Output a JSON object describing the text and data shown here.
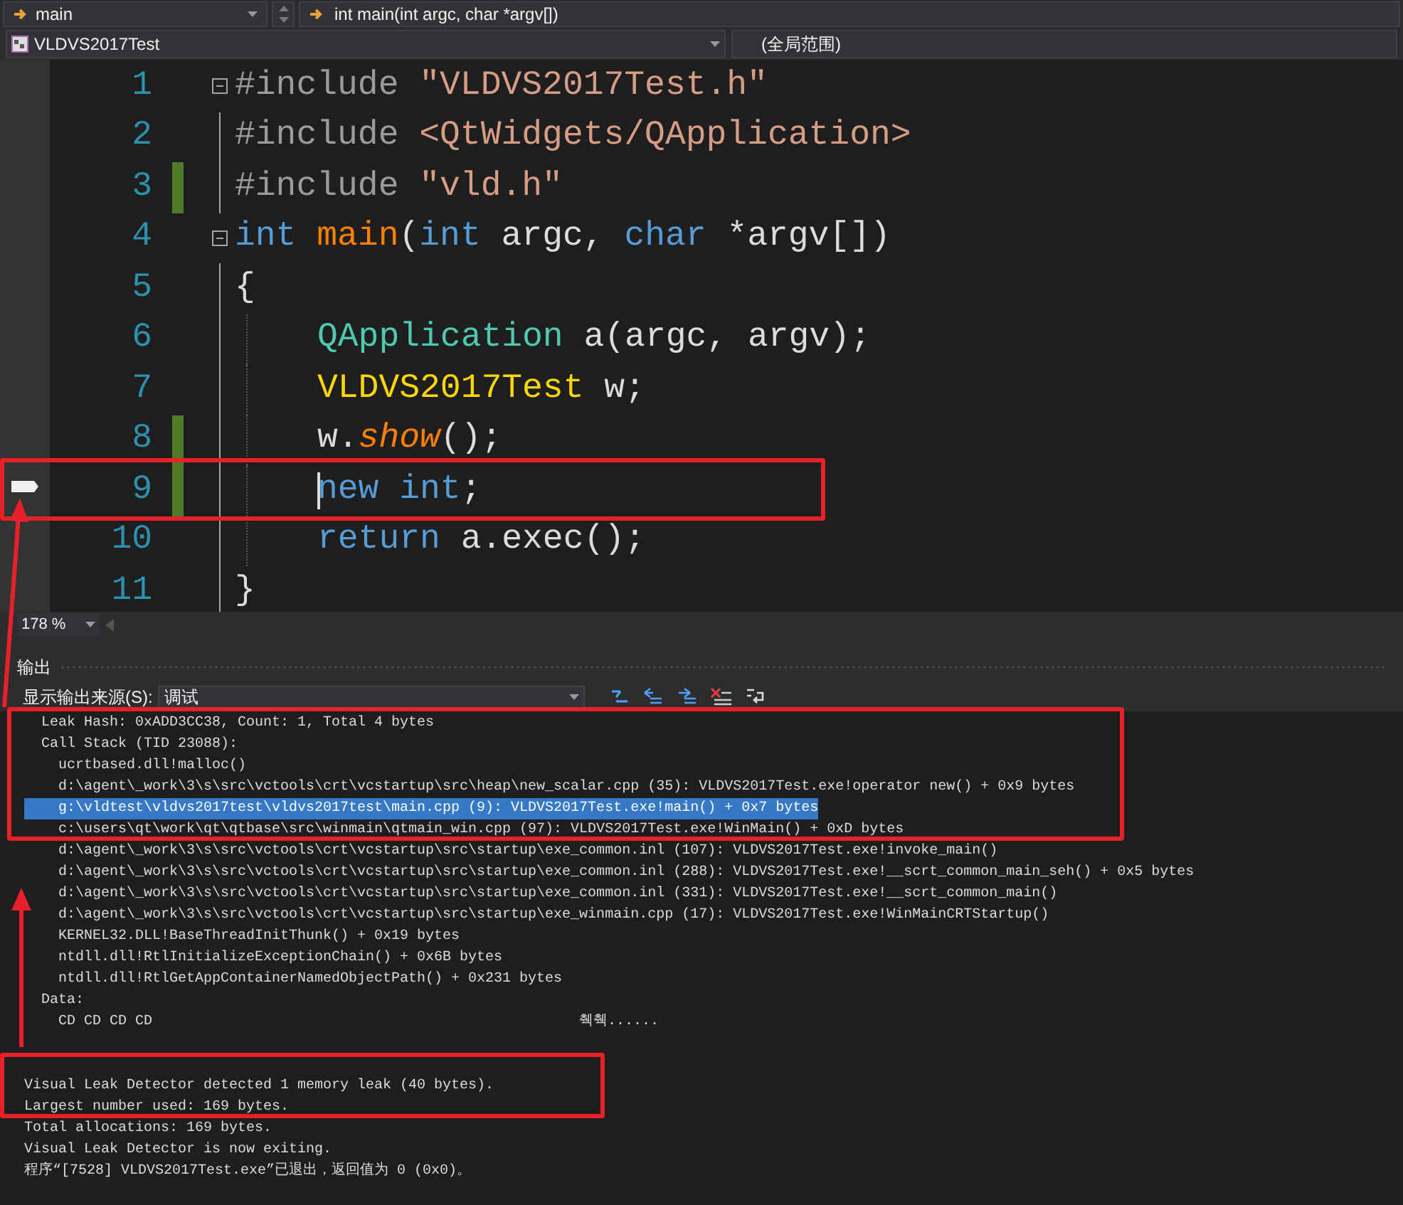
{
  "navigation_bar": {
    "member_dropdown": "main",
    "function_dropdown": "int main(int argc, char *argv[])"
  },
  "scope_bar": {
    "project_dropdown": "VLDVS2017Test",
    "scope_dropdown": "(全局范围)"
  },
  "editor": {
    "lines": [
      {
        "number": "1",
        "collapsible": true,
        "changed": false,
        "marker": false,
        "nested": false,
        "caret": false,
        "tokens": [
          {
            "t": "#include",
            "kind": "pre"
          },
          {
            "t": " \"VLDVS2017Test.h\"",
            "kind": "str"
          }
        ]
      },
      {
        "number": "2",
        "collapsible": false,
        "changed": false,
        "marker": false,
        "nested": false,
        "caret": false,
        "tokens": [
          {
            "t": "#include",
            "kind": "pre"
          },
          {
            "t": " <QtWidgets/QApplication>",
            "kind": "str"
          }
        ]
      },
      {
        "number": "3",
        "collapsible": false,
        "changed": true,
        "marker": false,
        "nested": false,
        "caret": false,
        "tokens": [
          {
            "t": "#include",
            "kind": "pre"
          },
          {
            "t": " \"vld.h\"",
            "kind": "str"
          }
        ]
      },
      {
        "number": "4",
        "collapsible": true,
        "changed": false,
        "marker": false,
        "nested": false,
        "caret": false,
        "tokens": [
          {
            "t": "int",
            "kind": "kw"
          },
          {
            "t": " main",
            "kind": "fn"
          },
          {
            "t": "(",
            "kind": "plain"
          },
          {
            "t": "int",
            "kind": "kw"
          },
          {
            "t": " argc, ",
            "kind": "plain"
          },
          {
            "t": "char",
            "kind": "kw"
          },
          {
            "t": " *argv[])",
            "kind": "plain"
          }
        ]
      },
      {
        "number": "5",
        "collapsible": false,
        "changed": false,
        "marker": false,
        "nested": false,
        "caret": false,
        "tokens": [
          {
            "t": "{",
            "kind": "plain"
          }
        ]
      },
      {
        "number": "6",
        "collapsible": false,
        "changed": false,
        "marker": false,
        "nested": true,
        "caret": false,
        "tokens": [
          {
            "t": "QApplication",
            "kind": "cls"
          },
          {
            "t": " a(argc, argv);",
            "kind": "plain"
          }
        ]
      },
      {
        "number": "7",
        "collapsible": false,
        "changed": false,
        "marker": false,
        "nested": true,
        "caret": false,
        "tokens": [
          {
            "t": "VLDVS2017Test",
            "kind": "type"
          },
          {
            "t": " w;",
            "kind": "plain"
          }
        ]
      },
      {
        "number": "8",
        "collapsible": false,
        "changed": true,
        "marker": false,
        "nested": true,
        "caret": false,
        "tokens": [
          {
            "t": "w.",
            "kind": "plain"
          },
          {
            "t": "show",
            "kind": "method"
          },
          {
            "t": "();",
            "kind": "plain"
          }
        ]
      },
      {
        "number": "9",
        "collapsible": false,
        "changed": true,
        "marker": true,
        "nested": true,
        "caret": true,
        "tokens": [
          {
            "t": "new",
            "kind": "kw"
          },
          {
            "t": " int",
            "kind": "kw"
          },
          {
            "t": ";",
            "kind": "plain"
          }
        ]
      },
      {
        "number": "10",
        "collapsible": false,
        "changed": false,
        "marker": false,
        "nested": true,
        "caret": false,
        "tokens": [
          {
            "t": "return",
            "kind": "kw"
          },
          {
            "t": " a.exec();",
            "kind": "plain"
          }
        ]
      },
      {
        "number": "11",
        "collapsible": false,
        "changed": false,
        "marker": false,
        "nested": false,
        "caret": false,
        "tokens": [
          {
            "t": "}",
            "kind": "plain"
          }
        ]
      }
    ]
  },
  "zoom": "178 %",
  "output_panel": {
    "title": "输出",
    "source_label": "显示输出来源(S):",
    "source_dropdown": "调试",
    "lines": [
      {
        "kind": "entry",
        "selected": false,
        "text": "Leak Hash: 0xADD3CC38, Count: 1, Total 4 bytes"
      },
      {
        "kind": "entry",
        "selected": false,
        "text": "Call Stack (TID 23088):"
      },
      {
        "kind": "frame",
        "selected": false,
        "text": "ucrtbased.dll!malloc()"
      },
      {
        "kind": "frame",
        "selected": false,
        "text": "d:\\agent\\_work\\3\\s\\src\\vctools\\crt\\vcstartup\\src\\heap\\new_scalar.cpp (35): VLDVS2017Test.exe!operator new() + 0x9 bytes"
      },
      {
        "kind": "frame",
        "selected": true,
        "text": "g:\\vldtest\\vldvs2017test\\vldvs2017test\\main.cpp (9): VLDVS2017Test.exe!main() + 0x7 bytes"
      },
      {
        "kind": "frame",
        "selected": false,
        "text": "c:\\users\\qt\\work\\qt\\qtbase\\src\\winmain\\qtmain_win.cpp (97): VLDVS2017Test.exe!WinMain() + 0xD bytes"
      },
      {
        "kind": "frame",
        "selected": false,
        "text": "d:\\agent\\_work\\3\\s\\src\\vctools\\crt\\vcstartup\\src\\startup\\exe_common.inl (107): VLDVS2017Test.exe!invoke_main()"
      },
      {
        "kind": "frame",
        "selected": false,
        "text": "d:\\agent\\_work\\3\\s\\src\\vctools\\crt\\vcstartup\\src\\startup\\exe_common.inl (288): VLDVS2017Test.exe!__scrt_common_main_seh() + 0x5 bytes"
      },
      {
        "kind": "frame",
        "selected": false,
        "text": "d:\\agent\\_work\\3\\s\\src\\vctools\\crt\\vcstartup\\src\\startup\\exe_common.inl (331): VLDVS2017Test.exe!__scrt_common_main()"
      },
      {
        "kind": "frame",
        "selected": false,
        "text": "d:\\agent\\_work\\3\\s\\src\\vctools\\crt\\vcstartup\\src\\startup\\exe_winmain.cpp (17): VLDVS2017Test.exe!WinMainCRTStartup()"
      },
      {
        "kind": "frame",
        "selected": false,
        "text": "KERNEL32.DLL!BaseThreadInitThunk() + 0x19 bytes"
      },
      {
        "kind": "frame",
        "selected": false,
        "text": "ntdll.dll!RtlInitializeExceptionChain() + 0x6B bytes"
      },
      {
        "kind": "frame",
        "selected": false,
        "text": "ntdll.dll!RtlGetAppContainerNamedObjectPath() + 0x231 bytes"
      },
      {
        "kind": "entry",
        "selected": false,
        "text": "Data:"
      },
      {
        "kind": "data",
        "selected": false,
        "hex": "CD CD CD CD",
        "ascii": "췍췍......"
      },
      {
        "kind": "blank",
        "selected": false
      },
      {
        "kind": "blank",
        "selected": false
      },
      {
        "kind": "summary",
        "selected": false,
        "text": "Visual Leak Detector detected 1 memory leak (40 bytes)."
      },
      {
        "kind": "summary",
        "selected": false,
        "text": "Largest number used: 169 bytes."
      },
      {
        "kind": "summary",
        "selected": false,
        "text": "Total allocations: 169 bytes."
      },
      {
        "kind": "summary",
        "selected": false,
        "text": "Visual Leak Detector is now exiting."
      },
      {
        "kind": "summary",
        "selected": false,
        "text": "程序“[7528] VLDVS2017Test.exe”已退出，返回值为 0 (0x0)。"
      }
    ]
  }
}
